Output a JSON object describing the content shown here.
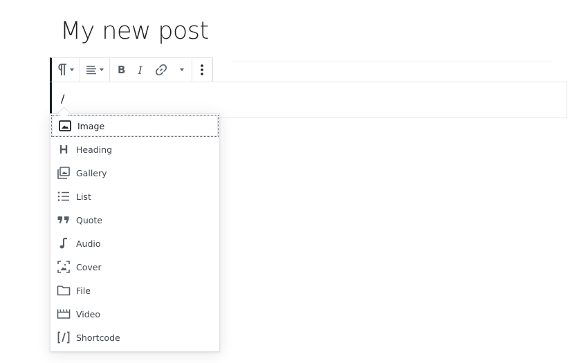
{
  "post": {
    "title": "My new post",
    "block_text": "/"
  },
  "toolbar": {
    "paragraph_icon": "paragraph-icon",
    "align_icon": "align-left-icon",
    "bold_label": "B",
    "italic_label": "I",
    "link_icon": "link-icon",
    "more_icon": "more-vertical-icon"
  },
  "inserter": {
    "items": [
      {
        "label": "Image",
        "icon": "image-icon",
        "selected": true
      },
      {
        "label": "Heading",
        "icon": "heading-icon"
      },
      {
        "label": "Gallery",
        "icon": "gallery-icon"
      },
      {
        "label": "List",
        "icon": "list-icon"
      },
      {
        "label": "Quote",
        "icon": "quote-icon"
      },
      {
        "label": "Audio",
        "icon": "audio-icon"
      },
      {
        "label": "Cover",
        "icon": "cover-icon"
      },
      {
        "label": "File",
        "icon": "file-icon"
      },
      {
        "label": "Video",
        "icon": "video-icon"
      },
      {
        "label": "Shortcode",
        "icon": "shortcode-icon"
      }
    ]
  }
}
